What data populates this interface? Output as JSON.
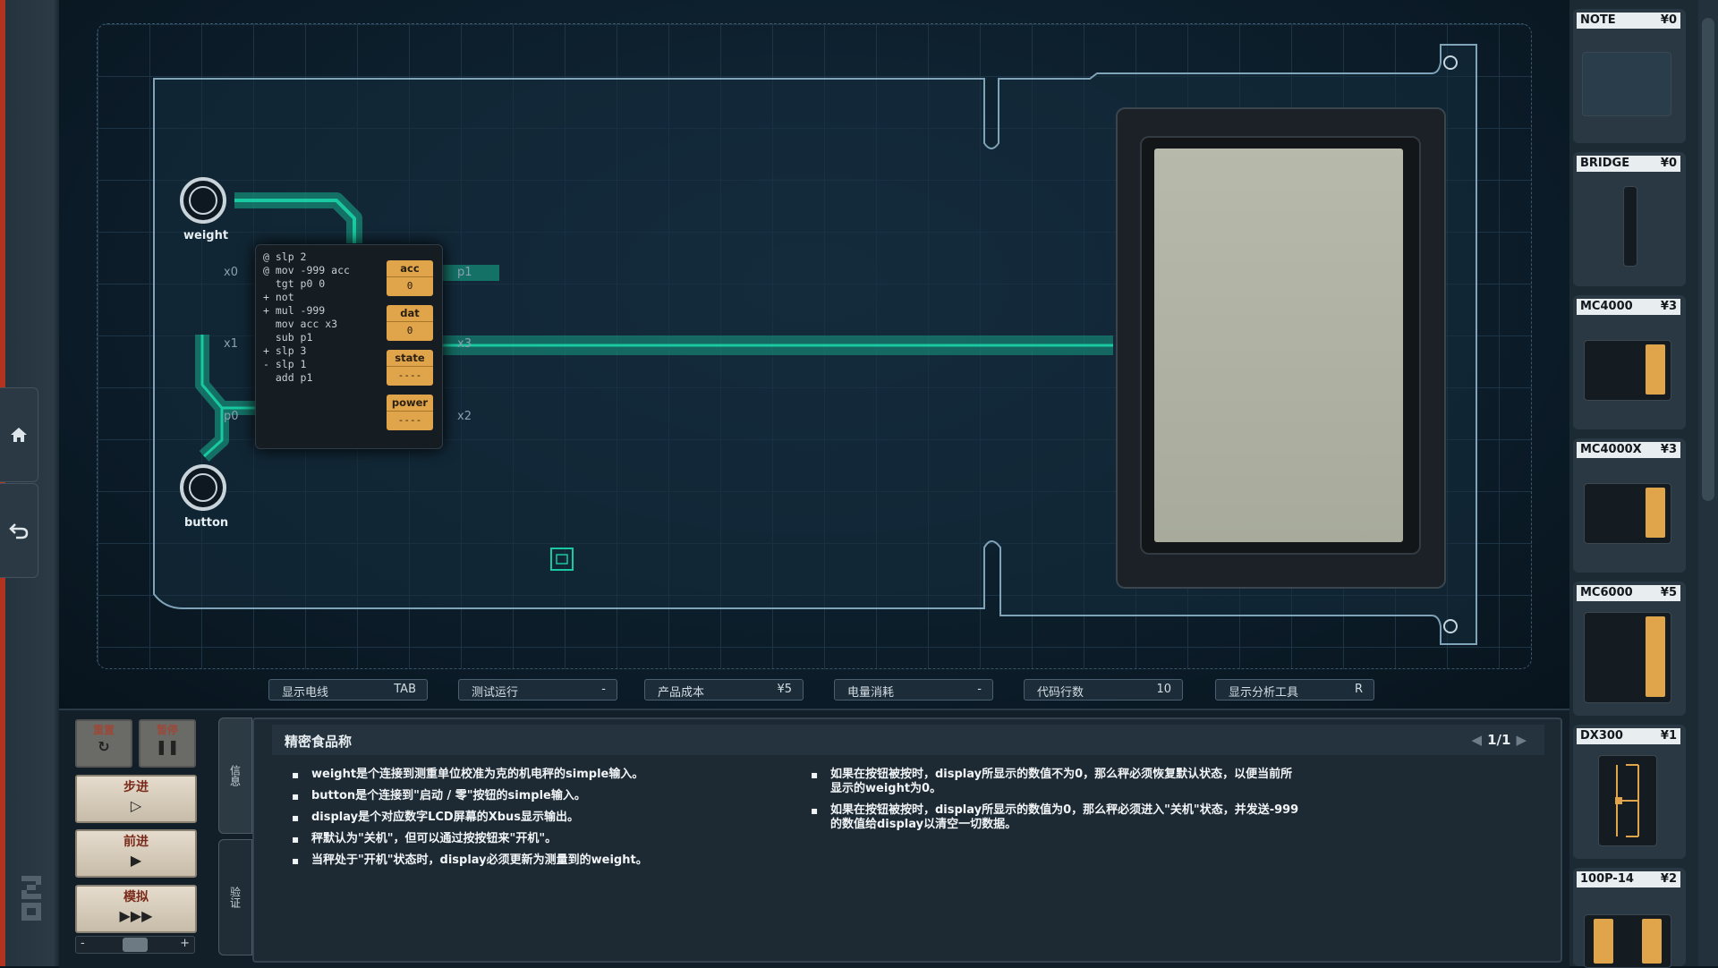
{
  "board": {
    "inputs": [
      {
        "name": "weight"
      },
      {
        "name": "button"
      }
    ],
    "ports": {
      "x0": "x0",
      "x1": "x1",
      "p0": "p0",
      "p1": "p1",
      "x3": "x3",
      "x2": "x2",
      "p1_right": "p1",
      "x3_right": "x3"
    }
  },
  "chip": {
    "code": "@ slp 2\n@ mov -999 acc\n  tgt p0 0\n+ not\n+ mul -999\n  mov acc x3\n  sub p1\n+ slp 3\n- slp 1\n  add p1",
    "registers": [
      {
        "name": "acc",
        "value": "0"
      },
      {
        "name": "dat",
        "value": "0"
      },
      {
        "name": "state",
        "value": "----"
      },
      {
        "name": "power",
        "value": "----"
      }
    ]
  },
  "status_bar": [
    {
      "label": "显示电线",
      "value": "TAB"
    },
    {
      "label": "测试运行",
      "value": "-"
    },
    {
      "label": "产品成本",
      "value": "¥5"
    },
    {
      "label": "电量消耗",
      "value": "-"
    },
    {
      "label": "代码行数",
      "value": "10"
    },
    {
      "label": "显示分析工具",
      "value": "R"
    }
  ],
  "controls": {
    "reset": {
      "label": "重置",
      "icon": "reset-icon"
    },
    "pause": {
      "label": "暂停",
      "icon": "pause-icon"
    },
    "step": {
      "label": "步进",
      "symbol": "▷"
    },
    "advance": {
      "label": "前进",
      "symbol": "▶"
    },
    "simulate": {
      "label": "模拟",
      "symbol": "▶▶▶"
    },
    "speed_minus": "-",
    "speed_plus": "+"
  },
  "side_tabs": {
    "info": "信息",
    "verify": "验证"
  },
  "task": {
    "title": "精密食品称",
    "page": "1/1",
    "left_bullets": [
      "weight是个连接到测重单位校准为克的机电秤的simple输入。",
      "button是个连接到\"启动 / 零\"按钮的simple输入。",
      "display是个对应数字LCD屏幕的Xbus显示输出。",
      "秤默认为\"关机\"，但可以通过按按钮来\"开机\"。",
      "当秤处于\"开机\"状态时，display必须更新为测量到的weight。"
    ],
    "right_bullets": [
      "如果在按钮被按时，display所显示的数值不为0，那么秤必须恢复默认状态，以便当前所显示的weight为0。",
      "如果在按钮被按时，display所显示的数值为0，那么秤必须进入\"关机\"状态，并发送-999的数值给display以清空一切数据。"
    ]
  },
  "palette": [
    {
      "name": "NOTE",
      "price": "¥0"
    },
    {
      "name": "BRIDGE",
      "price": "¥0"
    },
    {
      "name": "MC4000",
      "price": "¥3"
    },
    {
      "name": "MC4000X",
      "price": "¥3"
    },
    {
      "name": "MC6000",
      "price": "¥5"
    },
    {
      "name": "DX300",
      "price": "¥1"
    },
    {
      "name": "100P-14",
      "price": "¥2"
    }
  ],
  "colors": {
    "wire": "#19c9a0",
    "register": "#e0a54a",
    "accent_red": "#b2341f"
  }
}
